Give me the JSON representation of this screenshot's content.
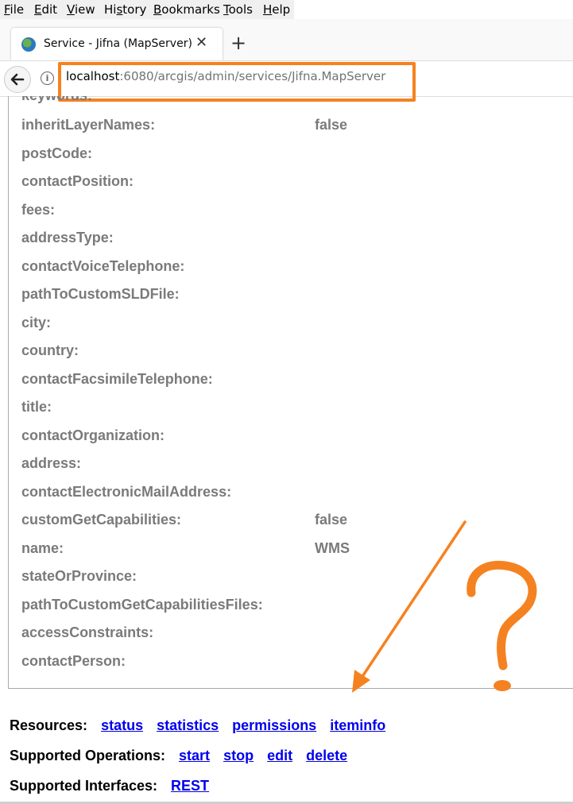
{
  "menu": [
    "File",
    "Edit",
    "View",
    "History",
    "Bookmarks",
    "Tools",
    "Help"
  ],
  "menu_underline": [
    "F",
    "E",
    "V",
    "s",
    "B",
    "T",
    "H"
  ],
  "tab": {
    "title": "Service - Jifna (MapServer)",
    "close": "✕",
    "new_tab": "+"
  },
  "url": {
    "host": "localhost",
    "rest": ":6080/arcgis/admin/services/Jifna.MapServer"
  },
  "properties": [
    {
      "key": "keywords:",
      "value": ""
    },
    {
      "key": "inheritLayerNames:",
      "value": "false"
    },
    {
      "key": "postCode:",
      "value": ""
    },
    {
      "key": "contactPosition:",
      "value": ""
    },
    {
      "key": "fees:",
      "value": ""
    },
    {
      "key": "addressType:",
      "value": ""
    },
    {
      "key": "contactVoiceTelephone:",
      "value": ""
    },
    {
      "key": "pathToCustomSLDFile:",
      "value": ""
    },
    {
      "key": "city:",
      "value": ""
    },
    {
      "key": "country:",
      "value": ""
    },
    {
      "key": "contactFacsimileTelephone:",
      "value": ""
    },
    {
      "key": "title:",
      "value": ""
    },
    {
      "key": "contactOrganization:",
      "value": ""
    },
    {
      "key": "address:",
      "value": ""
    },
    {
      "key": "contactElectronicMailAddress:",
      "value": ""
    },
    {
      "key": "customGetCapabilities:",
      "value": "false"
    },
    {
      "key": "name:",
      "value": "WMS"
    },
    {
      "key": "stateOrProvince:",
      "value": ""
    },
    {
      "key": "pathToCustomGetCapabilitiesFiles:",
      "value": ""
    },
    {
      "key": "accessConstraints:",
      "value": ""
    },
    {
      "key": "contactPerson:",
      "value": ""
    }
  ],
  "resources": {
    "label": "Resources:",
    "links": [
      "status",
      "statistics",
      "permissions",
      "iteminfo"
    ]
  },
  "operations": {
    "label": "Supported Operations:",
    "links": [
      "start",
      "stop",
      "edit",
      "delete"
    ]
  },
  "interfaces": {
    "label": "Supported Interfaces:",
    "links": [
      "REST"
    ]
  },
  "annotation": {
    "color": "#f58220",
    "question_mark": "?"
  }
}
